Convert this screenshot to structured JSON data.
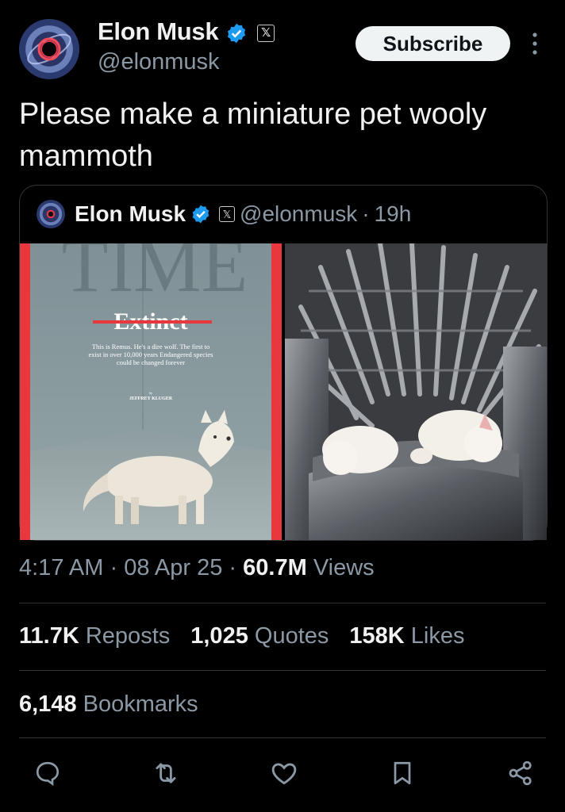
{
  "author": {
    "name": "Elon Musk",
    "handle": "@elonmusk",
    "x_badge": "𝕏"
  },
  "subscribe_label": "Subscribe",
  "tweet_text": "Please make a miniature pet wooly mammoth",
  "quoted": {
    "name": "Elon Musk",
    "x_badge": "𝕏",
    "handle": "@elonmusk",
    "separator": "·",
    "age": "19h",
    "cover": {
      "masthead": "TIME",
      "headline": "Extinct",
      "blurb": "This is Remus. He's a dire wolf. The first to exist in over 10,000 years Endangered species could be changed forever",
      "byline_prefix": "by",
      "byline": "JEFFREY KLUGER"
    }
  },
  "meta": {
    "time": "4:17 AM",
    "date": "08 Apr 25",
    "views_count": "60.7M",
    "views_label": "Views",
    "separator": "·"
  },
  "stats": {
    "reposts_count": "11.7K",
    "reposts_label": "Reposts",
    "quotes_count": "1,025",
    "quotes_label": "Quotes",
    "likes_count": "158K",
    "likes_label": "Likes",
    "bookmarks_count": "6,148",
    "bookmarks_label": "Bookmarks"
  },
  "colors": {
    "verified": "#1d9bf0",
    "background": "#000000",
    "muted": "#8b98a5",
    "cover_red": "#e8383d"
  },
  "icons": [
    "reply-icon",
    "repost-icon",
    "like-icon",
    "bookmark-icon",
    "share-icon"
  ]
}
